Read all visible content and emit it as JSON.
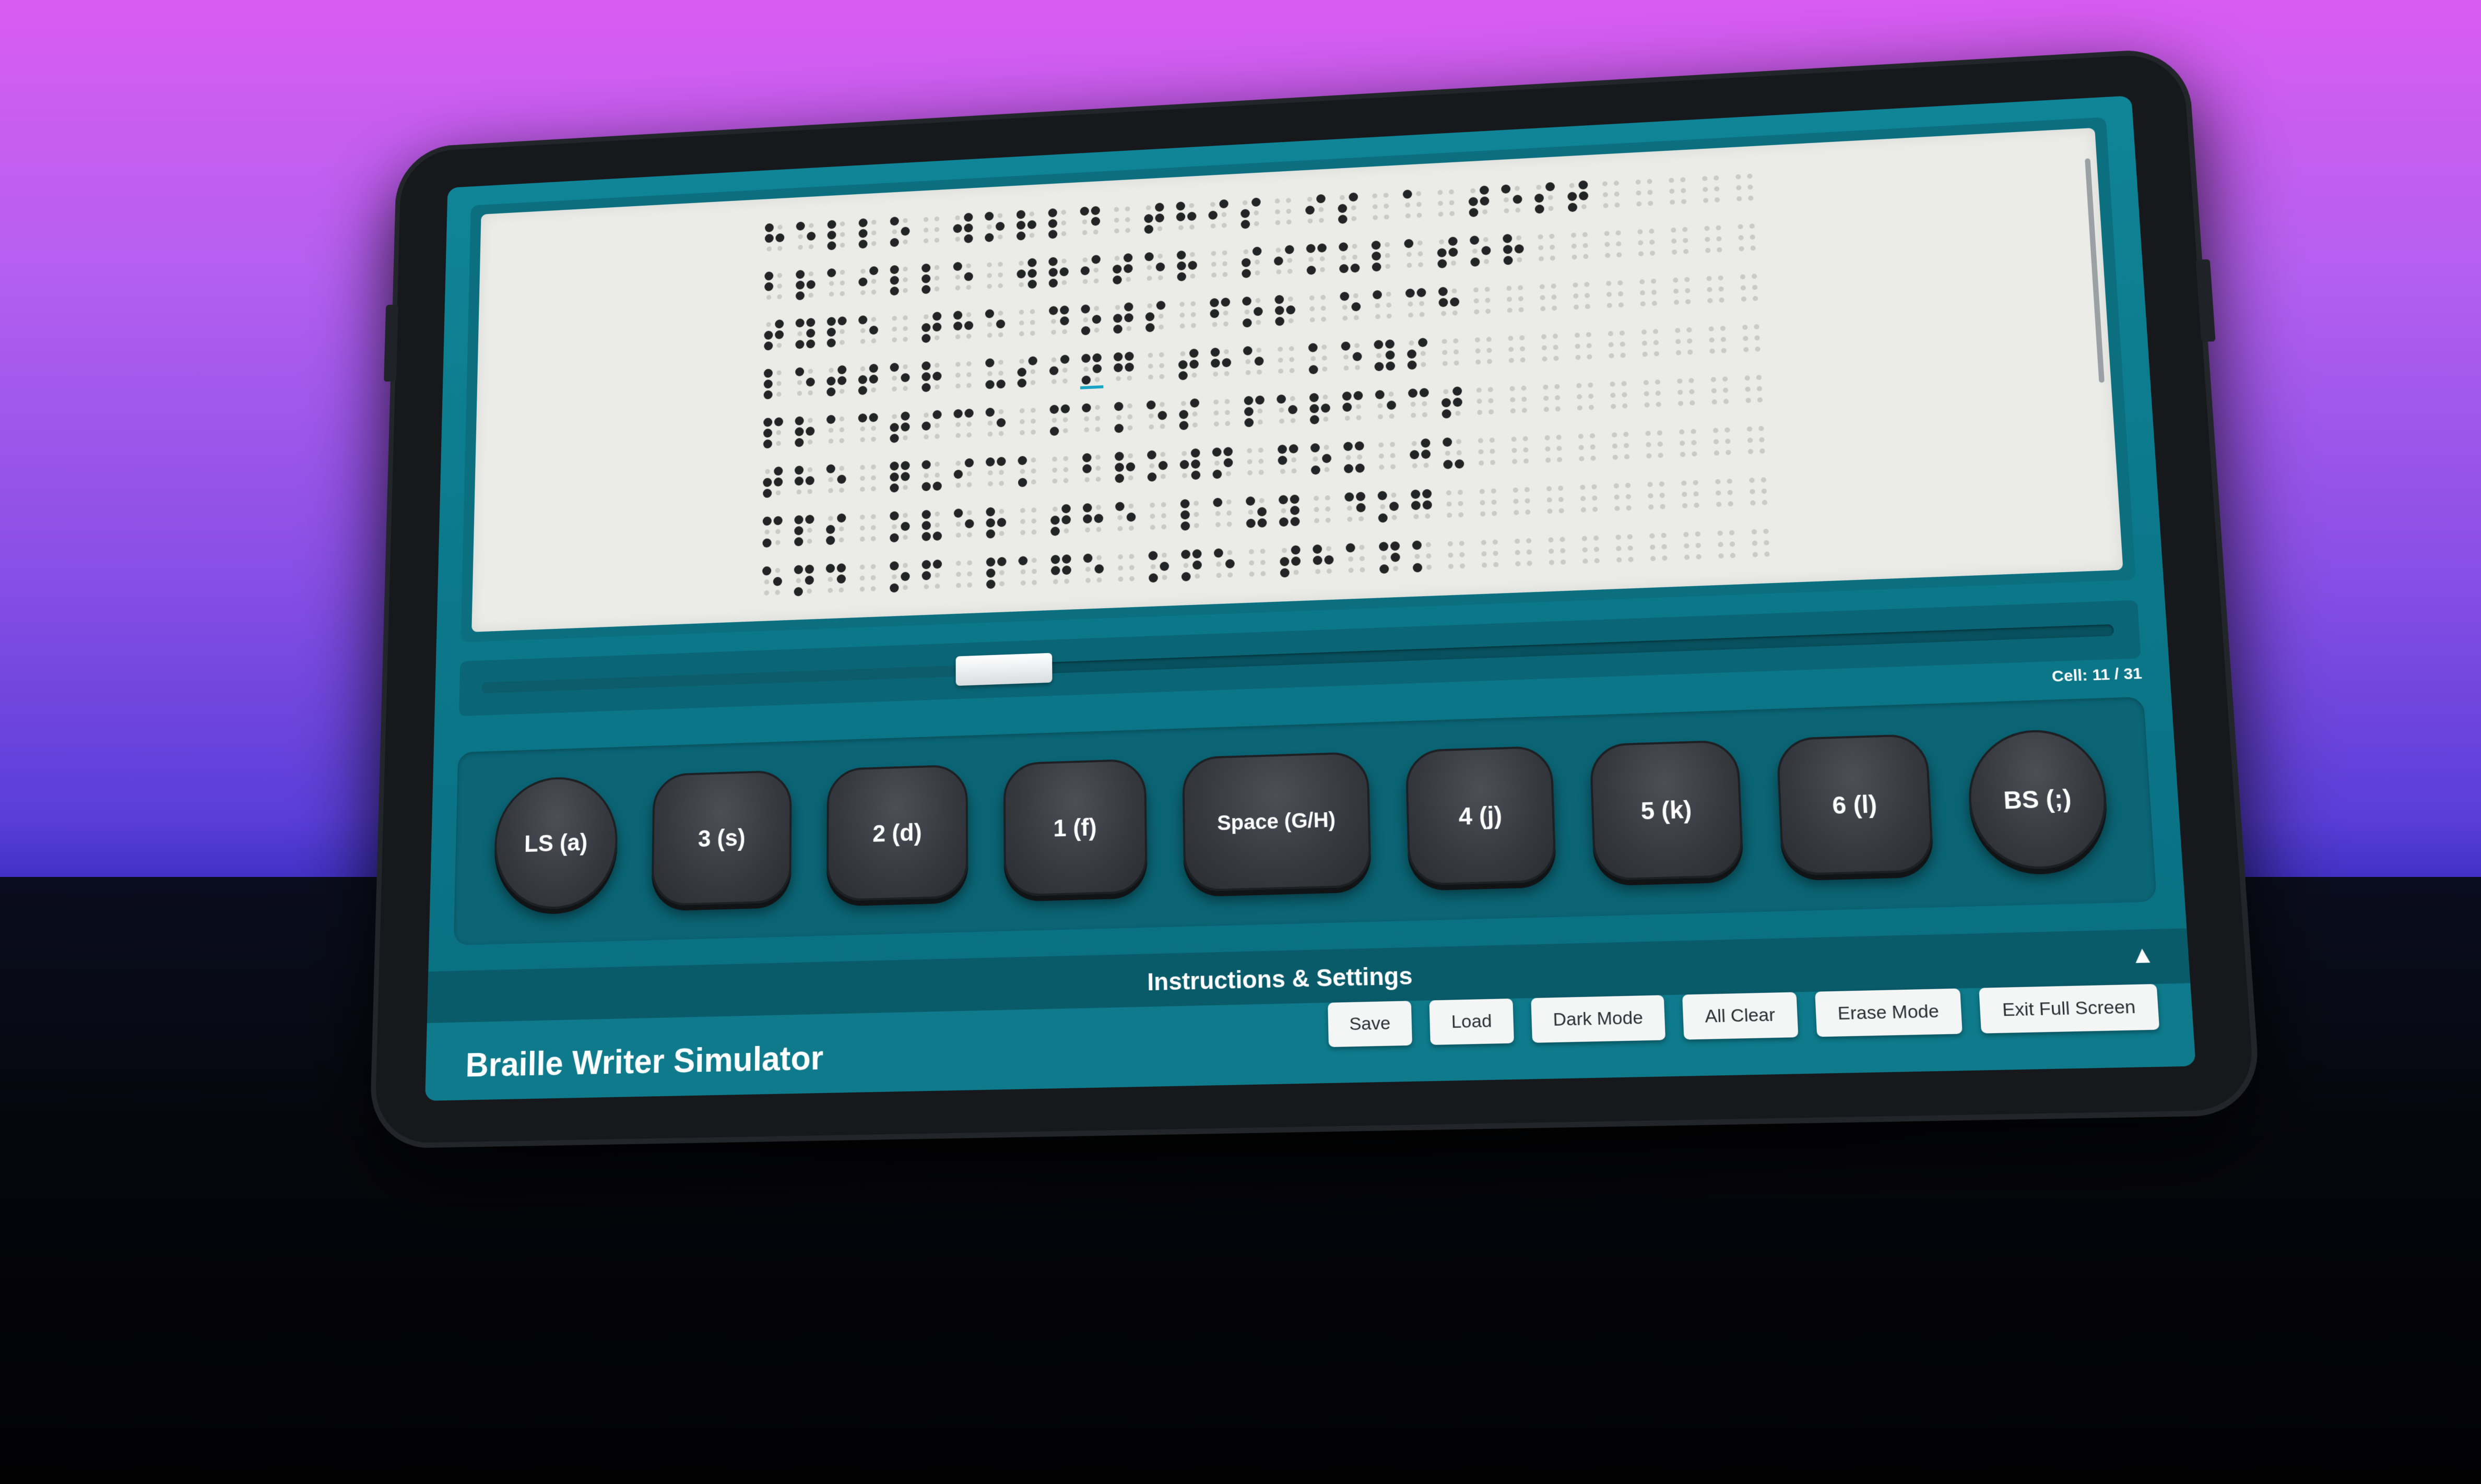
{
  "app": {
    "title": "Braille Writer Simulator"
  },
  "cursor": {
    "cell_label": "Cell: 11 / 31",
    "cell_current": 11,
    "cell_total": 31
  },
  "keys": [
    {
      "id": "ls",
      "label": "LS (a)",
      "shape": "round"
    },
    {
      "id": "dot3",
      "label": "3 (s)",
      "shape": "sq"
    },
    {
      "id": "dot2",
      "label": "2 (d)",
      "shape": "sq"
    },
    {
      "id": "dot1",
      "label": "1 (f)",
      "shape": "sq"
    },
    {
      "id": "space",
      "label": "Space (G/H)",
      "shape": "space"
    },
    {
      "id": "dot4",
      "label": "4 (j)",
      "shape": "sq"
    },
    {
      "id": "dot5",
      "label": "5 (k)",
      "shape": "sq"
    },
    {
      "id": "dot6",
      "label": "6 (l)",
      "shape": "sq"
    },
    {
      "id": "bs",
      "label": "BS (;)",
      "shape": "round"
    }
  ],
  "instructions": {
    "title": "Instructions & Settings",
    "toggle_icon": "▲"
  },
  "toolbar": {
    "save": "Save",
    "load": "Load",
    "dark_mode": "Dark Mode",
    "all_clear": "All Clear",
    "erase_mode": "Erase Mode",
    "exit_full_screen": "Exit Full Screen"
  },
  "colors": {
    "accent": "#0f8597",
    "paper": "#ebece8",
    "key": "#3a3d43",
    "cursor": "#1aa3c2"
  },
  "braille_lines": [
    "⠓⠑⠇⠇⠕⠀⠺⠕⠗⠇⠙⠀⠞⠓⠊⠎⠀⠊⠎⠀⠁⠀⠞⠑⠎⠞",
    "⠃⠗⠁⠊⠇⠇⠑⠀⠺⠗⠊⠞⠑⠗⠀⠎⠊⠍⠥⠇⠁⠞⠕⠗",
    "⠞⠽⠏⠑⠀⠞⠓⠑⠀⠙⠕⠞⠎⠀⠋⠕⠗⠀⠑⠁⠉⠓",
    "⠇⠑⠞⠞⠑⠗⠀⠥⠎⠊⠝⠛⠀⠞⠓⠑⠀⠅⠑⠽⠎",
    "⠏⠗⠁⠉⠞⠊⠉⠑⠀⠍⠁⠅⠑⠎⠀⠏⠑⠗⠋⠑⠉⠞",
    "⠞⠓⠑⠀⠟⠥⠊⠉⠅⠀⠃⠗⠕⠺⠝⠀⠋⠕⠭⠀⠚⠥",
    "⠍⠏⠎⠀⠕⠧⠑⠗⠀⠞⠓⠑⠀⠇⠁⠵⠽⠀⠙⠕⠛",
    "⠑⠝⠙⠀⠕⠋⠀⠏⠁⠛⠑⠀⠕⠝⠑⠀⠞⠓⠁⠝⠅"
  ]
}
